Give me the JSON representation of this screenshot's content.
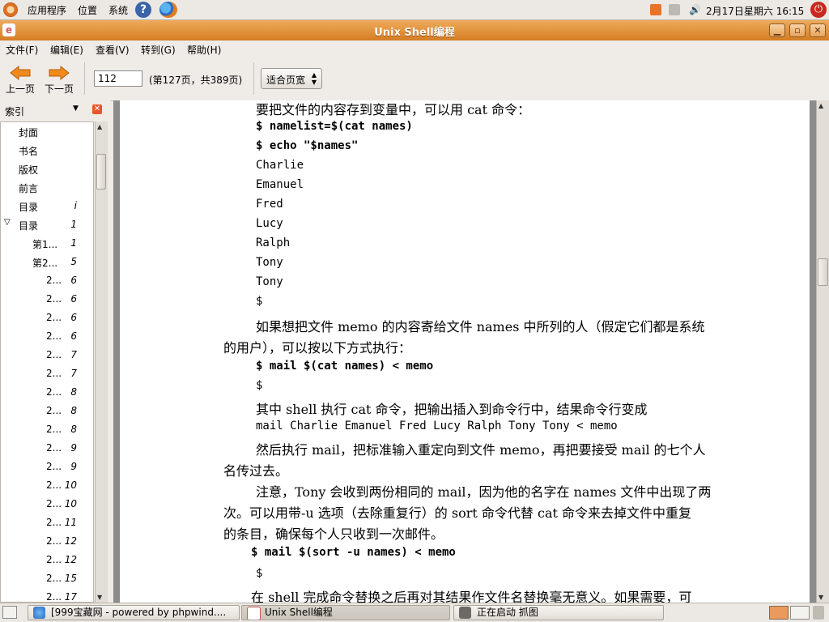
{
  "top_panel": {
    "menus": [
      "应用程序",
      "位置",
      "系统"
    ],
    "clock": "2月17日星期六 16:15"
  },
  "window": {
    "title": "Unix Shell编程"
  },
  "menubar": [
    "文件(F)",
    "编辑(E)",
    "查看(V)",
    "转到(G)",
    "帮助(H)"
  ],
  "toolbar": {
    "prev_label": "上一页",
    "next_label": "下一页",
    "page_value": "112",
    "page_info": "(第127页，共389页)",
    "zoom_value": "适合页宽"
  },
  "sidebar": {
    "title": "索引",
    "items": [
      {
        "title": "封面",
        "page": ""
      },
      {
        "title": "书名",
        "page": ""
      },
      {
        "title": "版权",
        "page": ""
      },
      {
        "title": "前言",
        "page": ""
      },
      {
        "title": "目录",
        "page": "i"
      },
      {
        "title": "目录",
        "page": "1"
      },
      {
        "title": "第1...",
        "page": "1"
      },
      {
        "title": "第2...",
        "page": "5"
      },
      {
        "title": "2...",
        "page": "6"
      },
      {
        "title": "2...",
        "page": "6"
      },
      {
        "title": "2...",
        "page": "6"
      },
      {
        "title": "2...",
        "page": "6"
      },
      {
        "title": "2...",
        "page": "7"
      },
      {
        "title": "2...",
        "page": "7"
      },
      {
        "title": "2...",
        "page": "8"
      },
      {
        "title": "2...",
        "page": "8"
      },
      {
        "title": "2...",
        "page": "8"
      },
      {
        "title": "2...",
        "page": "9"
      },
      {
        "title": "2...",
        "page": "9"
      },
      {
        "title": "2...",
        "page": "10"
      },
      {
        "title": "2...",
        "page": "10"
      },
      {
        "title": "2...",
        "page": "11"
      },
      {
        "title": "2...",
        "page": "12"
      },
      {
        "title": "2...",
        "page": "12"
      },
      {
        "title": "2...",
        "page": "15"
      },
      {
        "title": "2...",
        "page": "17"
      }
    ]
  },
  "document": {
    "lines": [
      {
        "style": "cn",
        "text": "要把文件的内容存到变量中，可以用 cat 命令："
      },
      {
        "style": "codeb",
        "text": "$ namelist=$(cat names)"
      },
      {
        "style": "codeb",
        "text": "$ echo \"$names\""
      },
      {
        "style": "code",
        "text": "Charlie"
      },
      {
        "style": "code",
        "text": "Emanuel"
      },
      {
        "style": "code",
        "text": "Fred"
      },
      {
        "style": "code",
        "text": "Lucy"
      },
      {
        "style": "code",
        "text": "Ralph"
      },
      {
        "style": "code",
        "text": "Tony"
      },
      {
        "style": "code",
        "text": "Tony"
      },
      {
        "style": "code",
        "text": "$"
      },
      {
        "style": "cn",
        "text": "如果想把文件 memo 的内容寄给文件 names 中所列的人（假定它们都是系统"
      },
      {
        "style": "cn",
        "text": "的用户），可以按以下方式执行："
      },
      {
        "style": "codeb",
        "text": "$ mail $(cat names) < memo"
      },
      {
        "style": "code",
        "text": "$"
      },
      {
        "style": "cn",
        "text": "其中 shell 执行 cat 命令，把输出插入到命令行中，结果命令行变成"
      },
      {
        "style": "code",
        "text": "mail Charlie Emanuel Fred Lucy Ralph Tony Tony < memo"
      },
      {
        "style": "cn",
        "text": "然后执行 mail，把标准输入重定向到文件 memo，再把要接受 mail 的七个人"
      },
      {
        "style": "cn",
        "text": "名传过去。"
      },
      {
        "style": "cn",
        "text": "注意，Tony 会收到两份相同的 mail，因为他的名字在 names 文件中出现了两"
      },
      {
        "style": "cn",
        "text": "次。可以用带-u 选项（去除重复行）的 sort 命令代替 cat 命令来去掉文件中重复"
      },
      {
        "style": "cn",
        "text": "的条目，确保每个人只收到一次邮件。"
      },
      {
        "style": "codeb",
        "text": "$ mail $(sort -u names) < memo"
      },
      {
        "style": "code",
        "text": "$"
      },
      {
        "style": "cn",
        "text": "在 shell 完成命令替换之后再对其结果作文件名替换毫无意义。如果需要，可"
      }
    ]
  },
  "taskbar": {
    "tasks": [
      "[999宝藏网 - powered by phpwind....",
      "Unix Shell编程",
      "正在启动 抓图"
    ]
  }
}
